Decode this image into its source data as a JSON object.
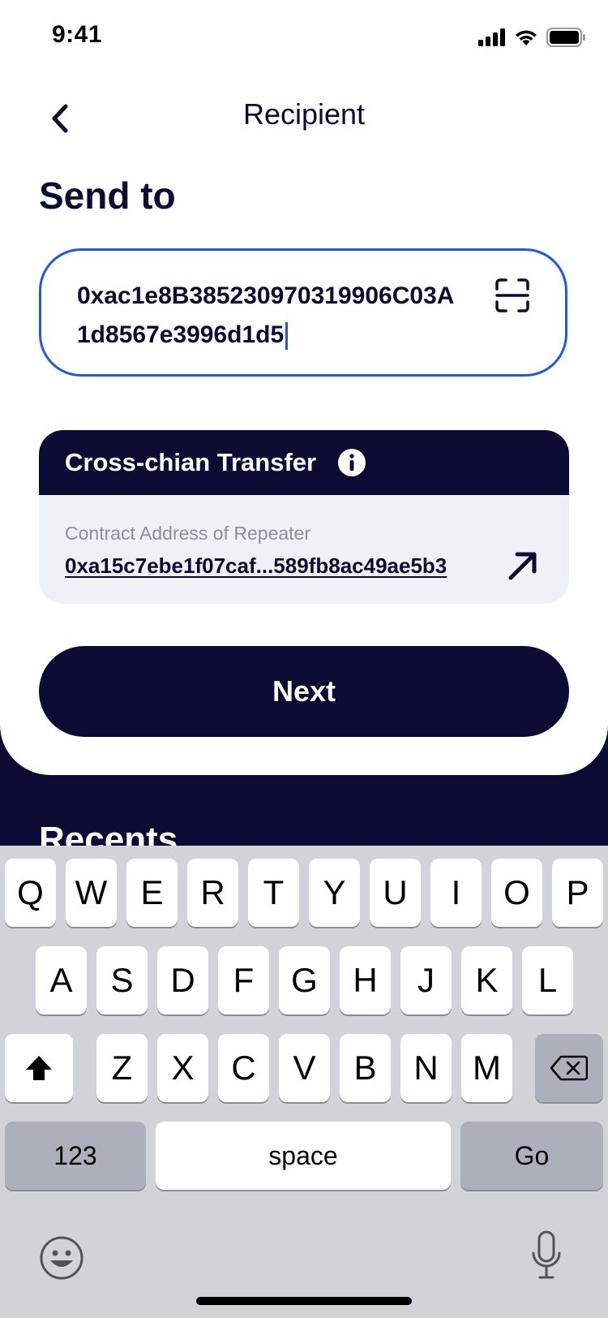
{
  "status": {
    "time": "9:41"
  },
  "nav": {
    "title": "Recipient"
  },
  "heading": "Send to",
  "address_input": {
    "value": "0xac1e8B385230970319906C03A1d8567e3996d1d5"
  },
  "cross_chain": {
    "title": "Cross-chian Transfer",
    "label": "Contract Address of Repeater",
    "address": "0xa15c7ebe1f07caf...589fb8ac49ae5b3"
  },
  "next_button": "Next",
  "recents": "Recents",
  "keyboard": {
    "row1": [
      "Q",
      "W",
      "E",
      "R",
      "T",
      "Y",
      "U",
      "I",
      "O",
      "P"
    ],
    "row2": [
      "A",
      "S",
      "D",
      "F",
      "G",
      "H",
      "J",
      "K",
      "L"
    ],
    "row3": [
      "Z",
      "X",
      "C",
      "V",
      "B",
      "N",
      "M"
    ],
    "numbers": "123",
    "space": "space",
    "go": "Go"
  },
  "colors": {
    "navy": "#0b0b33",
    "accent_blue": "#1f5bd9",
    "card_bg": "#eef2f6"
  }
}
